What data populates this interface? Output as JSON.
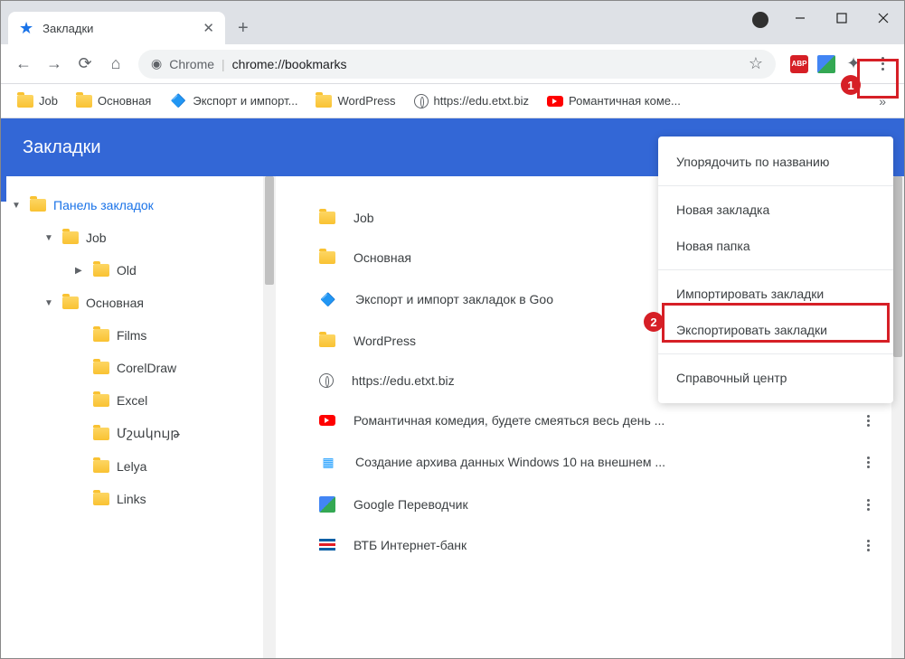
{
  "window": {
    "title": "Закладки"
  },
  "toolbar": {
    "brand": "Chrome",
    "url": "chrome://bookmarks",
    "abp": "ABP"
  },
  "bookmarks_bar": {
    "items": [
      {
        "label": "Job",
        "icon": "folder"
      },
      {
        "label": "Основная",
        "icon": "folder"
      },
      {
        "label": "Экспорт и импорт...",
        "icon": "custom"
      },
      {
        "label": "WordPress",
        "icon": "folder"
      },
      {
        "label": "https://edu.etxt.biz",
        "icon": "globe"
      },
      {
        "label": "Романтичная коме...",
        "icon": "yt"
      }
    ]
  },
  "header": {
    "title": "Закладки"
  },
  "sidebar": {
    "root": "Панель закладок",
    "items": [
      {
        "label": "Job"
      },
      {
        "label": "Old"
      },
      {
        "label": "Основная"
      },
      {
        "label": "Films"
      },
      {
        "label": "CorelDraw"
      },
      {
        "label": "Excel"
      },
      {
        "label": "Մշակույթ"
      },
      {
        "label": "Lelya"
      },
      {
        "label": "Links"
      }
    ]
  },
  "list": {
    "items": [
      {
        "label": "Job",
        "icon": "folder"
      },
      {
        "label": "Основная",
        "icon": "folder"
      },
      {
        "label": "Экспорт и импорт закладок в Goo",
        "icon": "custom-diamond"
      },
      {
        "label": "WordPress",
        "icon": "folder"
      },
      {
        "label": "https://edu.etxt.biz",
        "icon": "globe"
      },
      {
        "label": "Романтичная комедия, будете смеяться весь день ...",
        "icon": "yt"
      },
      {
        "label": "Создание архива данных Windows 10 на внешнем ...",
        "icon": "custom-box"
      },
      {
        "label": "Google Переводчик",
        "icon": "gtranslate"
      },
      {
        "label": "ВТБ Интернет-банк",
        "icon": "vtb"
      }
    ]
  },
  "menu": {
    "sort": "Упорядочить по названию",
    "new_bookmark": "Новая закладка",
    "new_folder": "Новая папка",
    "import": "Импортировать закладки",
    "export": "Экспортировать закладки",
    "help": "Справочный центр"
  },
  "badges": {
    "step1": "1",
    "step2": "2"
  }
}
